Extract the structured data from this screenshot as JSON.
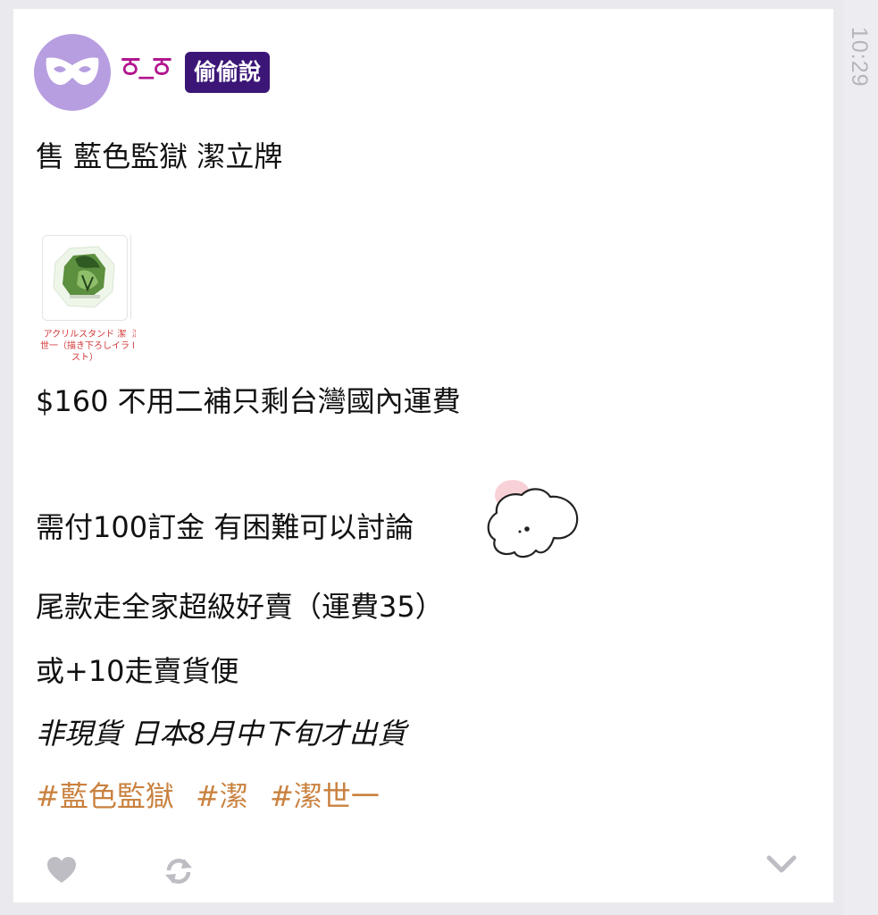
{
  "post": {
    "author": {
      "name": "ਠ_ਠ",
      "badge": "偷偷說",
      "avatar_icon": "mask-icon"
    },
    "timestamp": "10:29",
    "lines": [
      "售 藍色監獄 潔立牌",
      "$160 不用二補只剩台灣國內運費",
      "需付100訂金 有困難可以討論",
      "尾款走全家超級好賣（運費35）",
      "或+10走賣貨便",
      "非現貨 日本8月中下旬才出貨"
    ],
    "link_preview": {
      "caption": "アクリルスタンド 潔世一（描き下ろしイラスト）",
      "caption_cut": "潔 l"
    },
    "hashtags": [
      "#藍色監獄",
      "#潔",
      "#潔世一"
    ],
    "actions": {
      "like_icon": "heart-icon",
      "repost_icon": "repost-icon",
      "expand_icon": "chevron-down-icon"
    },
    "colors": {
      "avatar_bg": "#b79ee0",
      "username": "#b2158f",
      "badge_bg": "#3b1677",
      "hashtag": "#c9813f",
      "icon_gray": "#bdbdc3"
    }
  }
}
